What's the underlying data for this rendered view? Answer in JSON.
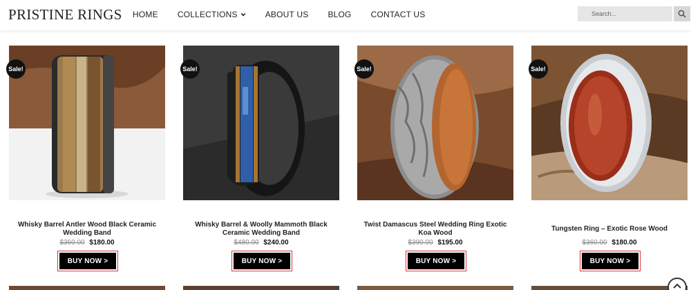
{
  "header": {
    "logo": "PRISTINE RINGS",
    "nav": [
      {
        "label": "HOME"
      },
      {
        "label": "COLLECTIONS"
      },
      {
        "label": "ABOUT US"
      },
      {
        "label": "BLOG"
      },
      {
        "label": "CONTACT US"
      }
    ],
    "search": {
      "placeholder": "Search...",
      "icon": "search-icon"
    }
  },
  "products": [
    {
      "title": "Whisky Barrel Antler Wood Black Ceramic Wedding Band",
      "badge": "Sale!",
      "old_price": "$360.00",
      "price": "$180.00",
      "button": "BUY NOW >"
    },
    {
      "title": "Whisky Barrel & Woolly Mammoth Black Ceramic Wedding Band",
      "badge": "Sale!",
      "old_price": "$480.00",
      "price": "$240.00",
      "button": "BUY NOW >"
    },
    {
      "title": "Twist Damascus Steel Wedding Ring Exotic Koa Wood",
      "badge": "Sale!",
      "old_price": "$390.00",
      "price": "$195.00",
      "button": "BUY NOW >"
    },
    {
      "title": "Tungsten Ring – Exotic Rose Wood",
      "badge": "Sale!",
      "old_price": "$360.00",
      "price": "$180.00",
      "button": "BUY NOW >"
    }
  ],
  "colors": {
    "badge": "#111111",
    "button_bg": "#000000",
    "button_outline": "#dd3333"
  }
}
